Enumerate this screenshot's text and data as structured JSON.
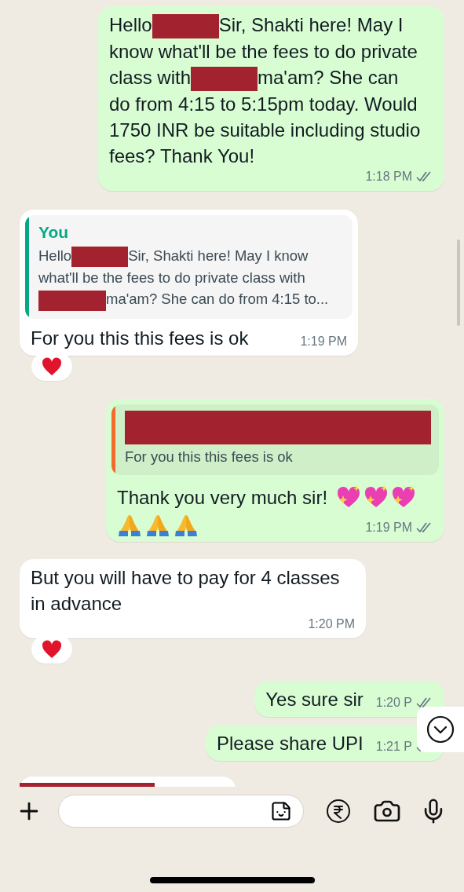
{
  "messages": [
    {
      "kind": "text",
      "outgoing": true,
      "parts": [
        {
          "kind": "text",
          "text": "Hello"
        },
        {
          "kind": "redacted"
        },
        {
          "kind": "text",
          "text": "Sir, Shakti here! May I know what'll be the fees to do private class with"
        },
        {
          "kind": "redacted"
        },
        {
          "kind": "text",
          "text": "ma'am? She can do from 4:15 to 5:15pm today. Would 1750 INR be suitable including studio fees? Thank You!"
        }
      ],
      "time": "1:18 PM",
      "delivered": true
    },
    {
      "kind": "text",
      "outgoing": false,
      "quote": {
        "author": "You",
        "color": "#06a884",
        "parts": [
          {
            "kind": "text",
            "text": "Hello"
          },
          {
            "kind": "redacted"
          },
          {
            "kind": "text",
            "text": "Sir, Shakti here! May I know what'll be the fees to do private class with "
          },
          {
            "kind": "redacted"
          },
          {
            "kind": "text",
            "text": "ma'am? She can do from 4:15 to..."
          }
        ]
      },
      "parts": [
        {
          "kind": "text",
          "text": "For you this this fees is ok"
        }
      ],
      "time": "1:19 PM",
      "reacted": true
    },
    {
      "kind": "emoji",
      "outgoing": true,
      "quote": {
        "author_hidden": true,
        "color": "#f26b2c",
        "parts": [
          {
            "kind": "text",
            "text": "For you this this fees is ok"
          }
        ]
      },
      "parts": [
        {
          "kind": "text",
          "text": "Thank you very much sir!"
        }
      ],
      "time": "1:19 PM",
      "delivered": true
    },
    {
      "kind": "text",
      "outgoing": false,
      "parts": [
        {
          "kind": "text",
          "text": "But you will have to pay for 4 classes in advance"
        }
      ],
      "time": "1:20 PM",
      "reacted": true
    },
    {
      "kind": "text",
      "outgoing": true,
      "parts": [
        {
          "kind": "text",
          "text": "Yes sure sir"
        }
      ],
      "time": "1:20 P",
      "delivered": true
    },
    {
      "kind": "text",
      "outgoing": true,
      "parts": [
        {
          "kind": "text",
          "text": "Please share UPI"
        }
      ],
      "time": "1:21 P",
      "delivered": true
    },
    {
      "kind": "redacted_preview",
      "outgoing": false
    }
  ]
}
